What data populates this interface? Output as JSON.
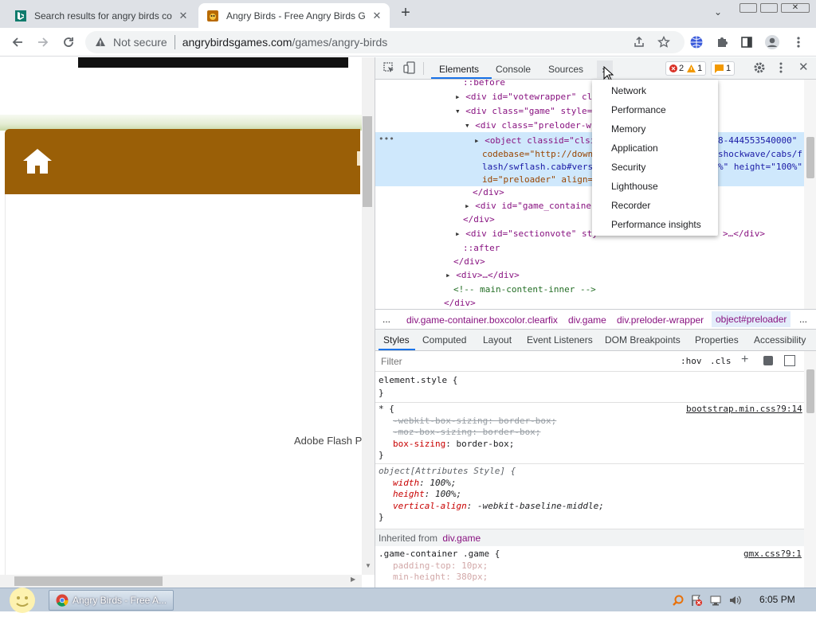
{
  "tabs": [
    {
      "title": "Search results for angry birds co"
    },
    {
      "title": "Angry Birds - Free Angry Birds G"
    }
  ],
  "toolbar": {
    "security_label": "Not secure",
    "url_domain": "angrybirdsgames.com",
    "url_path": "/games/angry-birds"
  },
  "page": {
    "flash_text": "Adobe Flash P"
  },
  "devtools": {
    "tabs": [
      "Elements",
      "Console",
      "Sources"
    ],
    "more_tabs": "»",
    "error_count": "2",
    "warning_count": "1",
    "issue_count": "1",
    "overflow_menu": [
      "Network",
      "Performance",
      "Memory",
      "Application",
      "Security",
      "Lighthouse",
      "Recorder",
      "Performance insights"
    ],
    "breadcrumbs": [
      "...",
      "div.game-container.boxcolor.clearfix",
      "div.game",
      "div.preloder-wrapper",
      "object#preloader",
      "..."
    ],
    "style_tabs": [
      "Styles",
      "Computed",
      "Layout",
      "Event Listeners",
      "DOM Breakpoints",
      "Properties",
      "Accessibility"
    ],
    "filter_placeholder": "Filter",
    "hov_label": ":hov",
    "cls_label": ".cls",
    "inherited_label": "Inherited from",
    "inherited_selector": "div.game",
    "rule_sources": [
      "bootstrap.min.css?9:14",
      "gmx.css?9:1"
    ],
    "dom_tree": {
      "l1": "::before",
      "l2a": "<div id=\"votewrapper\" cla",
      "l3a": "<div class=\"game\" style=\"",
      "l4a": "<div class=\"preloder-wra",
      "l5a": "<object classid=\"clsi",
      "l5b": "8-444553540000\"",
      "l6a": "codebase=\"http://down",
      "l6b": "shockwave/cabs/f",
      "l7a": "lash/swflash.cab#vers",
      "l7b": "%\" height=\"100%\"",
      "l8a": "id=\"preloader\" align=",
      "l9": "</div>",
      "l10": "<div id=\"game_container",
      "l11": "</div>",
      "l12a": "<div id=\"sectionvote\" sty",
      "l12b": ">…</div>",
      "l13": "::after",
      "l14": "</div>",
      "l15": "<div>…</div>",
      "l16": "<!-- main-content-inner -->",
      "l17": "</div>"
    },
    "styles": {
      "element_style": "element.style {",
      "close": "}",
      "star_sel": "* {",
      "p1": "-webkit-box-sizing: border-box;",
      "p2": "-moz-box-sizing: border-box;",
      "p3n": "box-sizing",
      "p3v": ": border-box;",
      "obj_sel": "object[Attributes Style] {",
      "w_n": "width",
      "w_v": ": 100%;",
      "h_n": "height",
      "h_v": ": 100%;",
      "va_n": "vertical-align",
      "va_v": ": -webkit-baseline-middle;",
      "gc_sel": ".game-container .game {",
      "pt": "padding-top: 10px;",
      "mh": "min-height: 380px;"
    }
  },
  "taskbar": {
    "task_title": "Angry Birds - Free A...",
    "clock": "6:05 PM"
  },
  "colors": {
    "tabstrip": "#dee1e6",
    "site_brown": "#9a5f07",
    "selection": "#cfe8fc",
    "accent_blue": "#1a73e8",
    "taskbar": "#c0cddb"
  }
}
